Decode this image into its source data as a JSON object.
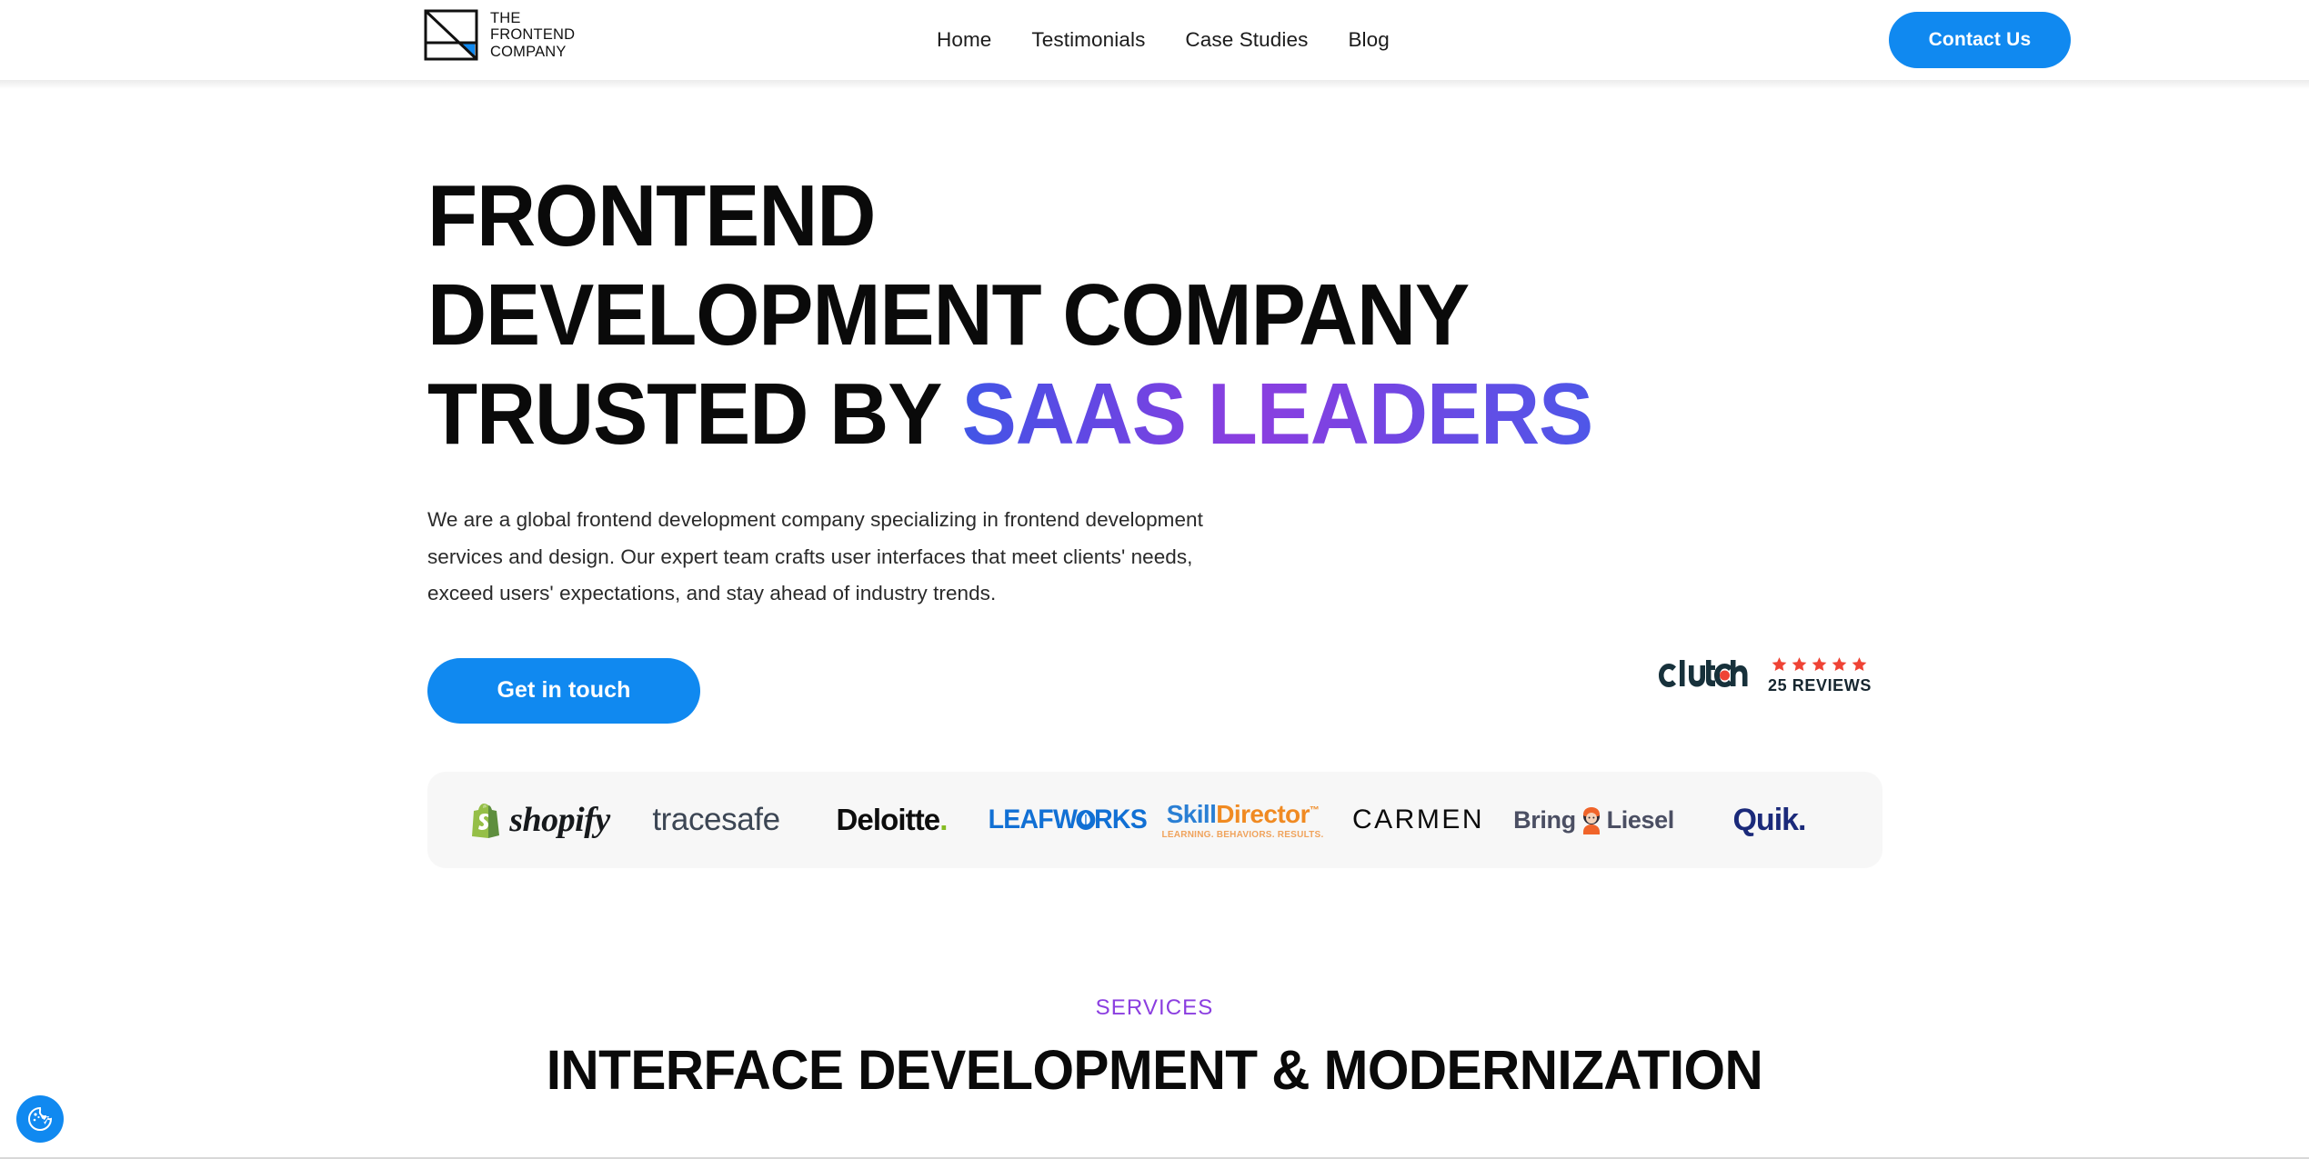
{
  "header": {
    "logo": {
      "icon": "frontend-company-mark-icon",
      "text": "THE\nFRONTEND\nCOMPANY",
      "accent_color": "#1089f0"
    },
    "nav": [
      {
        "label": "Home"
      },
      {
        "label": "Testimonials"
      },
      {
        "label": "Case Studies"
      },
      {
        "label": "Blog"
      }
    ],
    "contact_button": "Contact Us"
  },
  "hero": {
    "headline_line1": "FRONTEND",
    "headline_line2": "DEVELOPMENT COMPANY",
    "headline_line3_prefix": "TRUSTED BY ",
    "headline_line3_accent": "SAAS LEADERS",
    "subtext": "We are a global frontend development company specializing in frontend development services and design. Our expert team crafts user interfaces that meet clients' needs, exceed users' expectations, and stay ahead of industry trends.",
    "cta_button": "Get in touch",
    "accent_gradient_start": "#4156e6",
    "accent_gradient_mid": "#8b3ee0",
    "accent_gradient_end": "#4e57e8",
    "button_color": "#1089f0"
  },
  "clutch": {
    "brand": "Clutch",
    "stars": 5,
    "star_color": "#ef4335",
    "reviews_label": "25 REVIEWS",
    "logo_color": "#17313b"
  },
  "client_logos": [
    {
      "name": "Shopify",
      "text": "shopify",
      "color": "#16191c",
      "mark": "shopify-bag-icon"
    },
    {
      "name": "tracesafe",
      "text": "tracesafe",
      "color": "#3c4654"
    },
    {
      "name": "Deloitte",
      "text": "Deloitte",
      "suffix": ".",
      "color": "#0d0d0d",
      "accent": "#85bc22"
    },
    {
      "name": "LEAFWORKS",
      "text": "LEAFWORKS",
      "color": "#1170d4",
      "mark": "leaf-icon"
    },
    {
      "name": "SkillDirector",
      "text_a": "Skill",
      "text_b": "Director",
      "trademark": "™",
      "tagline": "LEARNING. BEHAVIORS. RESULTS.",
      "color_a": "#2a7fd4",
      "color_b": "#f08a22"
    },
    {
      "name": "CARMEN",
      "text": "CARMEN",
      "color": "#0b0b0b"
    },
    {
      "name": "Bring Liesel",
      "text_a": "Bring",
      "text_b": "Liesel",
      "color": "#4b4f63",
      "mark": "liesel-character-icon"
    },
    {
      "name": "Quik.",
      "text": "Quik.",
      "color": "#1b2a7a"
    }
  ],
  "services": {
    "eyebrow": "SERVICES",
    "eyebrow_color": "#8b3ee0",
    "title": "INTERFACE DEVELOPMENT & MODERNIZATION"
  },
  "accessibility_widget": {
    "icon": "accessibility-cookie-icon",
    "color": "#1089f0"
  }
}
